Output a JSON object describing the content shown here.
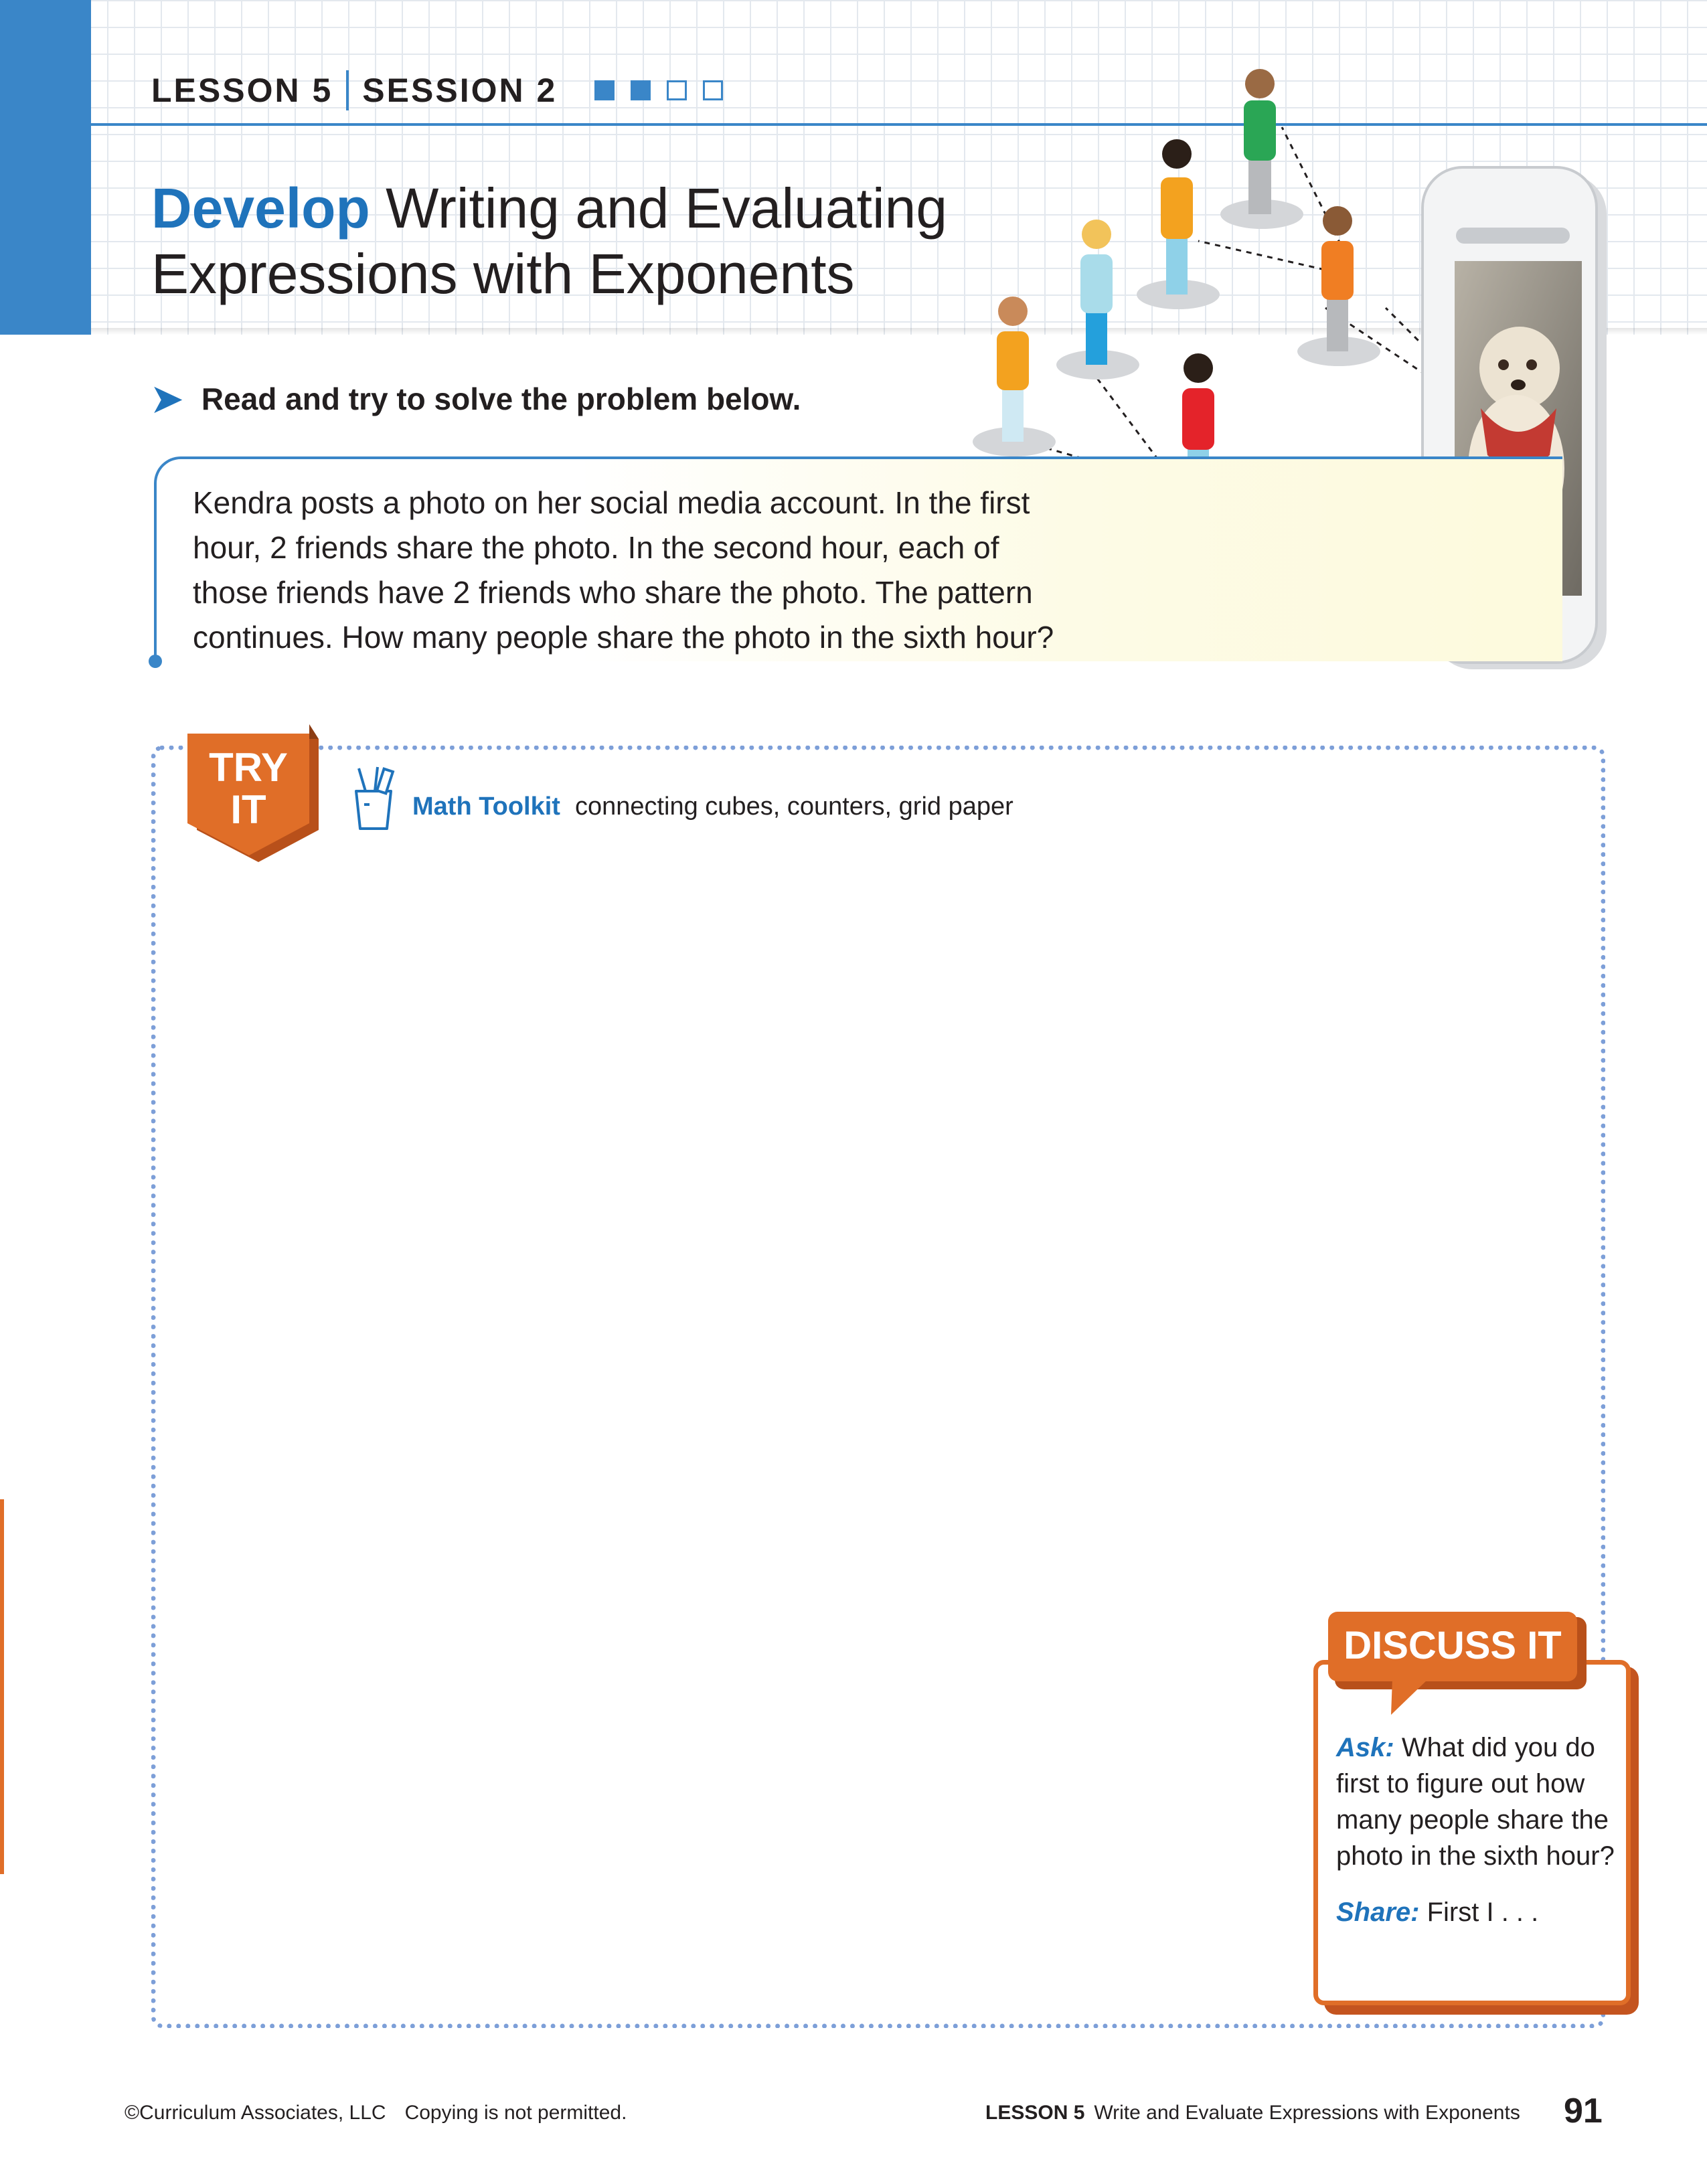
{
  "header": {
    "lesson_label": "LESSON 5",
    "session_label": "SESSION 2",
    "session_progress": {
      "completed": 2,
      "total": 4
    },
    "title_emphasis": "Develop",
    "title_rest": " Writing and Evaluating Expressions with Exponents"
  },
  "instruction": {
    "text": "Read and try to solve the problem below."
  },
  "problem": {
    "lines": [
      "Kendra posts a photo on her social media account. In the first",
      "hour, 2 friends share the photo. In the second hour, each of",
      "those friends have 2 friends who share the photo. The pattern",
      "continues. How many people share the photo in the sixth hour?"
    ]
  },
  "try_it": {
    "badge_line1": "TRY",
    "badge_line2": "IT",
    "toolkit_title": "Math Toolkit",
    "toolkit_items": "connecting cubes, counters, grid paper"
  },
  "discuss_it": {
    "badge": "DISCUSS IT",
    "ask_label": "Ask:",
    "ask_text": " What did you do first to figure out how many people share the photo in the sixth hour?",
    "share_label": "Share:",
    "share_text": " First I . . ."
  },
  "footer": {
    "copyright": "©Curriculum Associates, LLC",
    "no_copy": "Copying is not permitted.",
    "lesson_label": "LESSON 5",
    "lesson_title": "Write and Evaluate Expressions with Exponents",
    "page_number": "91"
  },
  "colors": {
    "brand_blue": "#3a86c8",
    "title_blue": "#1f73bb",
    "try_it_orange": "#e06e28",
    "dotted_border": "#7d9fd8"
  },
  "icons": [
    "arrow-right-icon",
    "pencil-cup-icon",
    "phone-icon",
    "person-icon"
  ]
}
